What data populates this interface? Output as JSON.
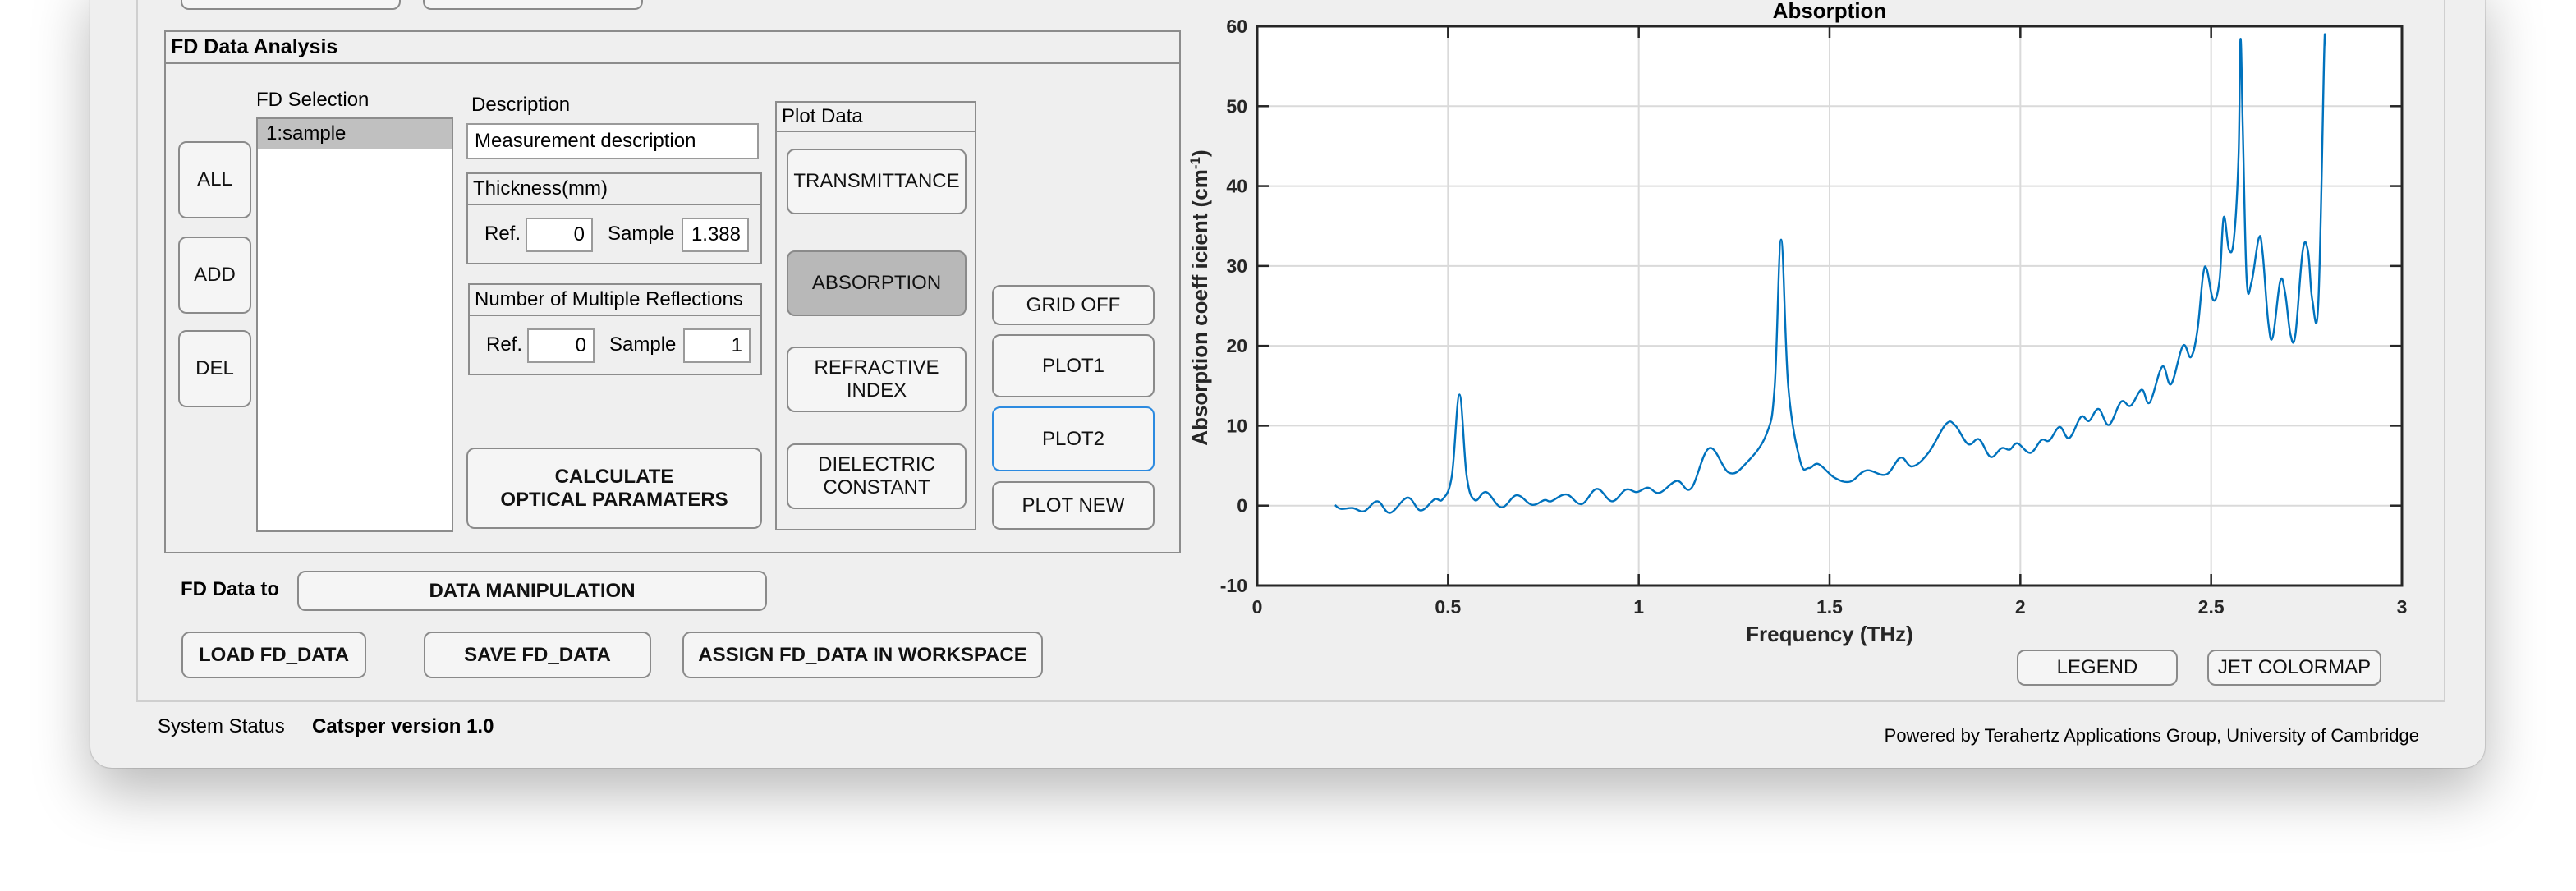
{
  "app": {
    "status_label": "System Status",
    "status_value": "Catsper version 1.0",
    "credit": "Powered by Terahertz Applications Group, University of Cambridge"
  },
  "analysis_panel": {
    "title": "FD Data Analysis",
    "selection": {
      "label": "FD Selection",
      "items": [
        "1:sample"
      ],
      "selected_index": 0
    },
    "list_buttons": {
      "all": "ALL",
      "add": "ADD",
      "del": "DEL"
    },
    "description": {
      "label": "Description",
      "value": "Measurement description"
    },
    "thickness": {
      "title": "Thickness(mm)",
      "ref_label": "Ref.",
      "ref_value": "0",
      "sample_label": "Sample",
      "sample_value": "1.388"
    },
    "reflections": {
      "title": "Number of Multiple Reflections",
      "ref_label": "Ref.",
      "ref_value": "0",
      "sample_label": "Sample",
      "sample_value": "1"
    },
    "calculate_button": {
      "line1": "CALCULATE",
      "line2": "OPTICAL PARAMATERS"
    },
    "plot_data": {
      "title": "Plot Data",
      "buttons": [
        {
          "line1": "TRANSMITTANCE",
          "line2": "",
          "selected": false
        },
        {
          "line1": "ABSORPTION",
          "line2": "",
          "selected": true
        },
        {
          "line1": "REFRACTIVE",
          "line2": "INDEX",
          "selected": false
        },
        {
          "line1": "DIELECTRIC",
          "line2": "CONSTANT",
          "selected": false
        }
      ]
    },
    "plot_controls": {
      "grid_off": "GRID OFF",
      "plot1": "PLOT1",
      "plot2": "PLOT2",
      "plot_new": "PLOT NEW",
      "focused": "PLOT2"
    }
  },
  "data_actions": {
    "fd_data_to_label": "FD Data to",
    "data_manipulation": "DATA MANIPULATION",
    "load": "LOAD FD_DATA",
    "save": "SAVE FD_DATA",
    "assign": "ASSIGN FD_DATA IN WORKSPACE"
  },
  "plot_buttons": {
    "legend": "LEGEND",
    "jet_colormap": "JET COLORMAP"
  },
  "colors": {
    "line": "#0072BD",
    "selected_button": "#b8b8b8",
    "focus_border": "#2c8ae0",
    "background": "#efefef"
  },
  "chart_data": {
    "type": "line",
    "title": "Absorption",
    "xlabel": "Frequency (THz)",
    "ylabel": "Absorption coeff icient (cm-1)",
    "ylabel_main": "Absorption  coeff icient  (cm",
    "ylabel_sup": "-1",
    "ylabel_end": ")",
    "xlim": [
      0,
      3
    ],
    "ylim": [
      -10,
      60
    ],
    "xticks": [
      0,
      0.5,
      1,
      1.5,
      2,
      2.5,
      3
    ],
    "xtick_labels": [
      "0",
      "0.5",
      "1",
      "1.5",
      "2",
      "2.5",
      "3"
    ],
    "yticks": [
      -10,
      0,
      10,
      20,
      30,
      40,
      50,
      60
    ],
    "ytick_labels": [
      "-10",
      "0",
      "10",
      "20",
      "30",
      "40",
      "50",
      "60"
    ],
    "grid": true,
    "legend": "none",
    "series": [
      {
        "name": "1:sample",
        "x": [
          0.204,
          0.219,
          0.25,
          0.28,
          0.315,
          0.348,
          0.394,
          0.428,
          0.465,
          0.486,
          0.51,
          0.53,
          0.549,
          0.57,
          0.6,
          0.64,
          0.68,
          0.72,
          0.753,
          0.77,
          0.81,
          0.85,
          0.89,
          0.93,
          0.966,
          0.995,
          1.024,
          1.054,
          1.1,
          1.137,
          1.185,
          1.237,
          1.283,
          1.335,
          1.356,
          1.373,
          1.392,
          1.423,
          1.446,
          1.471,
          1.513,
          1.554,
          1.596,
          1.648,
          1.686,
          1.717,
          1.759,
          1.805,
          1.83,
          1.863,
          1.892,
          1.922,
          1.951,
          1.972,
          1.992,
          2.026,
          2.055,
          2.076,
          2.103,
          2.128,
          2.159,
          2.18,
          2.205,
          2.232,
          2.264,
          2.289,
          2.318,
          2.339,
          2.372,
          2.395,
          2.426,
          2.447,
          2.464,
          2.479,
          2.489,
          2.506,
          2.522,
          2.533,
          2.547,
          2.56,
          2.572,
          2.577,
          2.583,
          2.593,
          2.606,
          2.625,
          2.635,
          2.65,
          2.662,
          2.681,
          2.694,
          2.708,
          2.721,
          2.74,
          2.754,
          2.765,
          2.781,
          2.796,
          2.798
        ],
        "y": [
          0.07,
          -0.4,
          -0.3,
          -0.7,
          0.55,
          -0.9,
          1.0,
          -0.6,
          0.8,
          0.8,
          3.7,
          13.9,
          3.7,
          0.7,
          1.7,
          -0.2,
          1.3,
          0.1,
          0.7,
          0.55,
          1.4,
          0.2,
          2.1,
          0.55,
          2.0,
          1.7,
          2.25,
          1.6,
          3.1,
          2.15,
          7.2,
          4.1,
          5.4,
          9.0,
          14.8,
          33.3,
          14.8,
          5.6,
          4.7,
          5.2,
          3.5,
          3.0,
          4.4,
          3.9,
          6.0,
          4.9,
          6.6,
          10.2,
          10.0,
          7.7,
          8.3,
          6.1,
          7.2,
          7.0,
          7.8,
          6.6,
          8.2,
          8.15,
          9.85,
          8.45,
          11.1,
          10.6,
          12.1,
          10.1,
          13.0,
          12.5,
          14.5,
          12.9,
          17.4,
          15.2,
          20.0,
          18.6,
          21.9,
          28.9,
          29.5,
          25.7,
          28.2,
          36.1,
          32.0,
          33.5,
          43.9,
          58.4,
          47.3,
          28.4,
          28.0,
          33.5,
          31.6,
          22.8,
          21.2,
          28.1,
          26.6,
          21.4,
          21.5,
          31.9,
          31.8,
          25.8,
          25.4,
          56.0,
          57.7
        ]
      }
    ]
  }
}
